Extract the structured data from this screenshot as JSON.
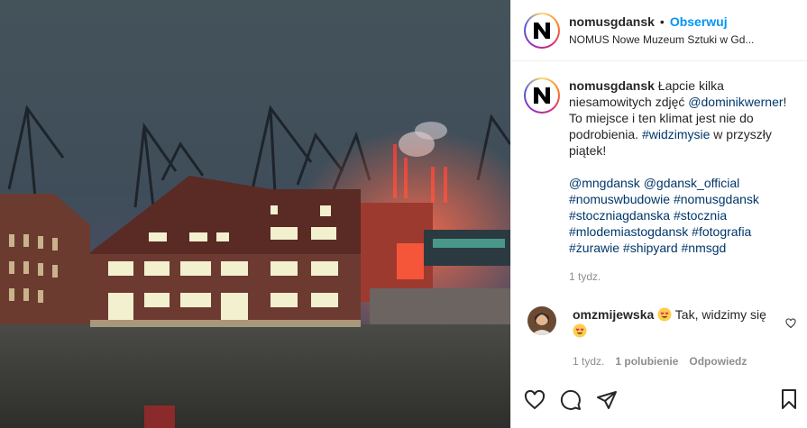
{
  "post": {
    "username": "nomusgdansk",
    "separator": "•",
    "follow_label": "Obserwuj",
    "location": "NOMUS Nowe Muzeum Sztuki w Gd..."
  },
  "caption": {
    "username": "nomusgdansk",
    "text_1": " Łapcie kilka niesamowitych zdjęć ",
    "mention_1": "@dominikwerner",
    "text_2": "! To miejsce i ten klimat jest nie do podrobienia. ",
    "hashtag_1": "#widzimysie",
    "text_3": " w przyszły piątek!",
    "tags_line": "@mngdansk @gdansk_official #nomuswbudowie #nomusgdansk #stoczniagdanska #stocznia #mlodemiastogdansk #fotografia #żurawie #shipyard #nmsgd",
    "time": "1 tydz."
  },
  "comment": {
    "username": "omzmijewska",
    "text": "Tak, widzimy się",
    "time": "1 tydz.",
    "likes": "1 polubienie",
    "reply_label": "Odpowiedz"
  },
  "icons": {
    "like": "heart-icon",
    "comment": "comment-icon",
    "share": "send-icon",
    "save": "bookmark-icon",
    "comment_like": "heart-icon"
  },
  "colors": {
    "follow": "#0095f6",
    "link": "#00376b",
    "muted": "#8e8e8e"
  }
}
